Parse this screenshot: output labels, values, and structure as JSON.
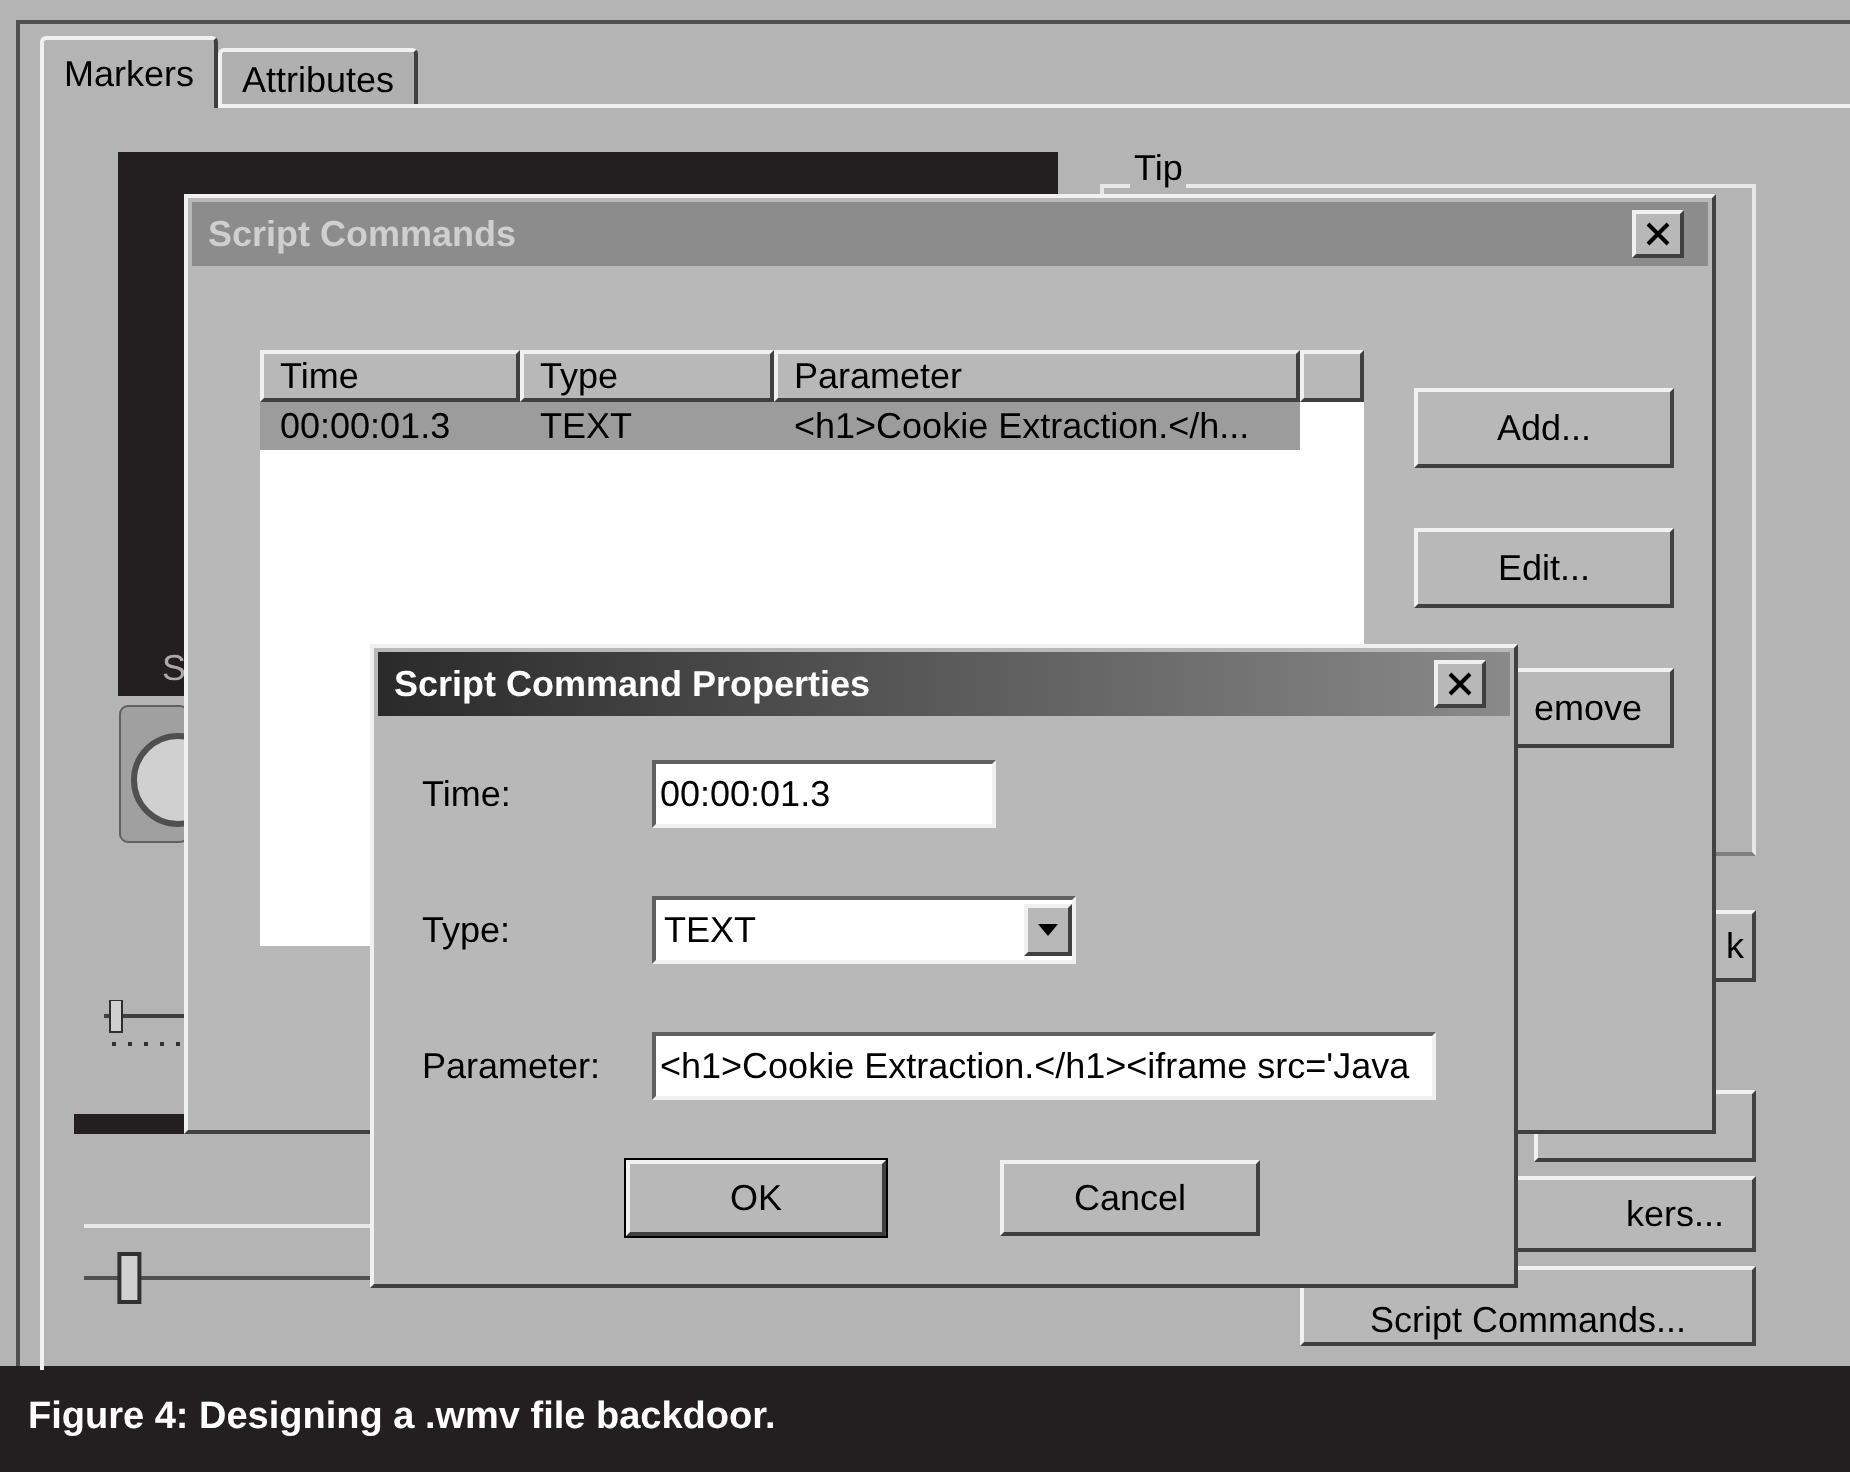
{
  "tabs": [
    {
      "label": "Markers",
      "selected": true
    },
    {
      "label": "Attributes",
      "selected": false
    }
  ],
  "sliders": [
    {
      "level": 0.05
    },
    {
      "level": 0.03
    }
  ],
  "background": {
    "video_text": "S",
    "tip_label": "Tip",
    "buttons": [
      {
        "label": "k"
      },
      {
        "label": "kers..."
      },
      {
        "label": "Script Commands..."
      }
    ]
  },
  "script_commands": {
    "title": "Script Commands",
    "active": false,
    "columns": [
      "Time",
      "Type",
      "Parameter"
    ],
    "rows": [
      {
        "cells": [
          "00:00:01.3",
          "TEXT",
          "<h1>Cookie Extraction.</h..."
        ],
        "selected": true
      }
    ],
    "buttons": [
      "Add...",
      "Edit...",
      "emove"
    ]
  },
  "properties": {
    "title": "Script Command Properties",
    "active": true,
    "fields": [
      {
        "label": "Time:",
        "kind": "text",
        "value": "00:00:01.3"
      },
      {
        "label": "Type:",
        "kind": "select",
        "value": "TEXT"
      },
      {
        "label": "Parameter:",
        "kind": "text",
        "value": "<h1>Cookie Extraction.</h1><iframe src='Java"
      }
    ],
    "buttons": [
      "OK",
      "Cancel"
    ]
  },
  "caption": "Figure 4: Designing a .wmv file backdoor."
}
